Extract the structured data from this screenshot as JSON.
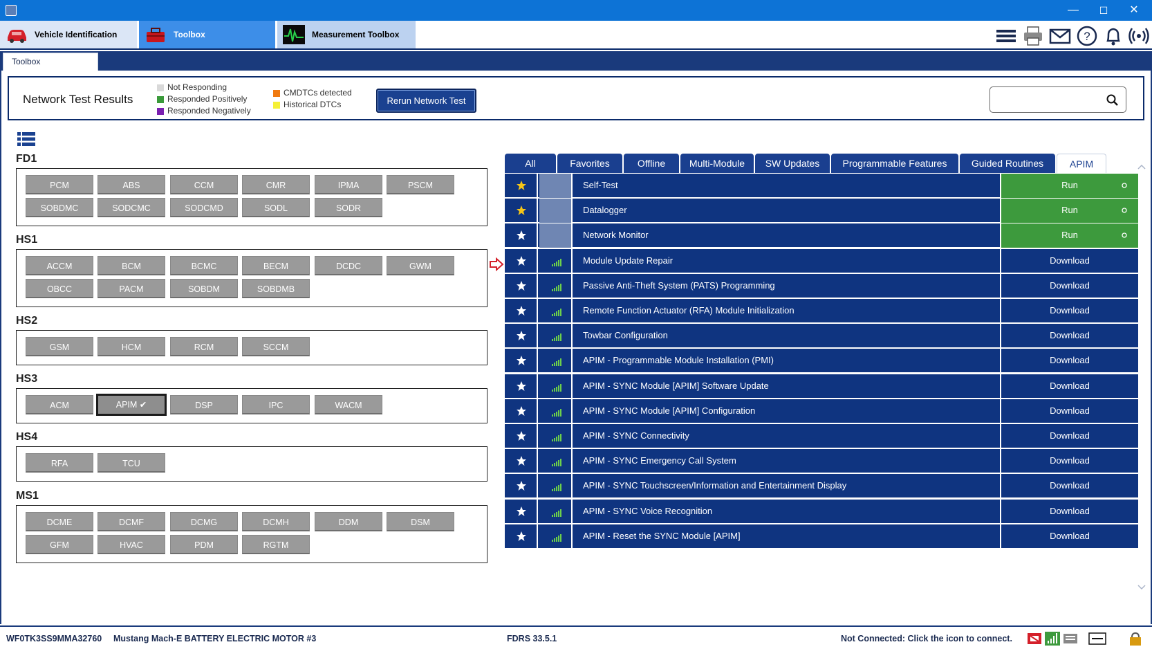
{
  "window": {
    "minimize": "—",
    "maximize": "☐",
    "close": "✕"
  },
  "main_tabs": [
    {
      "label": "Vehicle Identification"
    },
    {
      "label": "Toolbox"
    },
    {
      "label": "Measurement Toolbox"
    }
  ],
  "sub_tab": "Toolbox",
  "network_test": {
    "title": "Network Test Results",
    "legend": [
      {
        "label": "Not Responding",
        "color": "#d9d9d9"
      },
      {
        "label": "Responded Positively",
        "color": "#3a9a3a"
      },
      {
        "label": "Responded Negatively",
        "color": "#7a1fb0"
      },
      {
        "label": "CMDTCs detected",
        "color": "#f07a10"
      },
      {
        "label": "Historical DTCs",
        "color": "#f5f036"
      }
    ],
    "rerun_label": "Rerun Network Test",
    "search_placeholder": ""
  },
  "groups": [
    {
      "name": "FD1",
      "modules": [
        "PCM",
        "ABS",
        "CCM",
        "CMR",
        "IPMA",
        "PSCM",
        "SOBDMC",
        "SODCMC",
        "SODCMD",
        "SODL",
        "SODR"
      ]
    },
    {
      "name": "HS1",
      "modules": [
        "ACCM",
        "BCM",
        "BCMC",
        "BECM",
        "DCDC",
        "GWM",
        "OBCC",
        "PACM",
        "SOBDM",
        "SOBDMB"
      ]
    },
    {
      "name": "HS2",
      "modules": [
        "GSM",
        "HCM",
        "RCM",
        "SCCM"
      ]
    },
    {
      "name": "HS3",
      "modules": [
        "ACM",
        "APIM ✔",
        "DSP",
        "IPC",
        "WACM"
      ]
    },
    {
      "name": "HS4",
      "modules": [
        "RFA",
        "TCU"
      ]
    },
    {
      "name": "MS1",
      "modules": [
        "DCME",
        "DCMF",
        "DCMG",
        "DCMH",
        "DDM",
        "DSM",
        "GFM",
        "HVAC",
        "PDM",
        "RGTM"
      ]
    }
  ],
  "feature_tabs": [
    "All",
    "Favorites",
    "Offline",
    "Multi-Module",
    "SW Updates",
    "Programmable Features",
    "Guided Routines",
    "APIM"
  ],
  "active_feature_tab": "APIM",
  "rows": [
    {
      "name": "Self-Test",
      "action": "Run",
      "favorite": true
    },
    {
      "name": "Datalogger",
      "action": "Run",
      "favorite": true
    },
    {
      "name": "Network Monitor",
      "action": "Run",
      "favorite": false
    },
    {
      "name": "Module Update Repair",
      "action": "Download",
      "favorite": false
    },
    {
      "name": "Passive Anti-Theft System (PATS) Programming",
      "action": "Download",
      "favorite": false
    },
    {
      "name": "Remote Function Actuator (RFA) Module Initialization",
      "action": "Download",
      "favorite": false
    },
    {
      "name": "Towbar Configuration",
      "action": "Download",
      "favorite": false
    },
    {
      "name": "APIM - Programmable Module Installation (PMI)",
      "action": "Download",
      "favorite": false
    },
    {
      "name": "APIM - SYNC Module [APIM] Software Update",
      "action": "Download",
      "favorite": false
    },
    {
      "name": "APIM - SYNC Module [APIM] Configuration",
      "action": "Download",
      "favorite": false
    },
    {
      "name": "APIM - SYNC Connectivity",
      "action": "Download",
      "favorite": false
    },
    {
      "name": "APIM - SYNC Emergency Call System",
      "action": "Download",
      "favorite": false
    },
    {
      "name": "APIM - SYNC Touchscreen/Information and Entertainment Display",
      "action": "Download",
      "favorite": false
    },
    {
      "name": "APIM - SYNC Voice Recognition",
      "action": "Download",
      "favorite": false
    },
    {
      "name": "APIM - Reset the SYNC Module [APIM]",
      "action": "Download",
      "favorite": false
    }
  ],
  "status": {
    "vin": "WF0TK3SS9MMA32760",
    "vehicle": "Mustang Mach-E BATTERY ELECTRIC MOTOR #3",
    "version": "FDRS 33.5.1",
    "connection": "Not Connected: Click the icon to connect."
  },
  "colors": {
    "accent": "#0f3480",
    "run_green": "#3d9a3d",
    "titlebar": "#0d73d6"
  }
}
